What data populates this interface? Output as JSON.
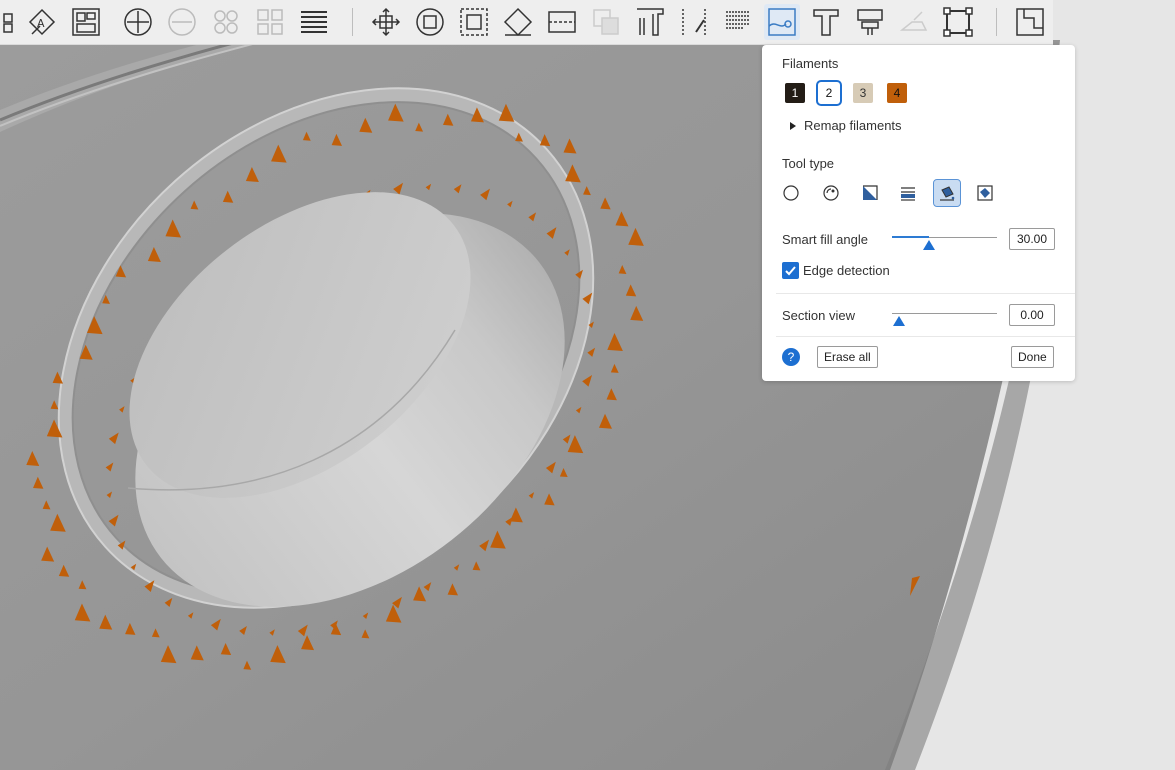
{
  "panel": {
    "filaments_title": "Filaments",
    "filaments": [
      {
        "label": "1",
        "color": "#231d16",
        "text_color": "#ffffff"
      },
      {
        "label": "2",
        "color": "#ffffff",
        "text_color": "#111111",
        "selected": true
      },
      {
        "label": "3",
        "color": "#d7cbb6",
        "text_color": "#333333"
      },
      {
        "label": "4",
        "color": "#c05f0a",
        "text_color": "#111111"
      }
    ],
    "remap_label": "Remap filaments",
    "tool_type_title": "Tool type",
    "tools": [
      {
        "name": "circle-tool-icon"
      },
      {
        "name": "sphere-tool-icon"
      },
      {
        "name": "triangle-tool-icon"
      },
      {
        "name": "height-range-tool-icon"
      },
      {
        "name": "fill-bucket-tool-icon",
        "active": true
      },
      {
        "name": "gap-fill-tool-icon"
      }
    ],
    "smart_fill_label": "Smart fill angle",
    "smart_fill_value": "30.00",
    "smart_fill_fraction": 0.35,
    "edge_detection_label": "Edge detection",
    "edge_detection_checked": true,
    "section_view_label": "Section view",
    "section_view_value": "0.00",
    "section_view_fraction": 0.0,
    "help_label": "?",
    "erase_all_label": "Erase all",
    "done_label": "Done"
  },
  "colors": {
    "accent": "#1d6fd1",
    "seam_marks": "#c05f0a"
  },
  "toolbar": {
    "icons": [
      "arrange-grid-icon",
      "auto-orient-icon",
      "arrange-icon",
      "add-plate-icon",
      "remove-plate-icon",
      "split-objects-icon",
      "split-parts-icon",
      "layers-icon",
      "move-icon",
      "rotate-icon",
      "scale-icon",
      "lay-on-face-icon",
      "cut-icon",
      "boolean-icon",
      "support-paint-icon",
      "seam-paint-icon",
      "fuzzy-skin-icon",
      "color-paint-icon",
      "text-icon",
      "measure-icon",
      "assembly-icon",
      "simplify-icon",
      "brim-ears-icon"
    ]
  }
}
